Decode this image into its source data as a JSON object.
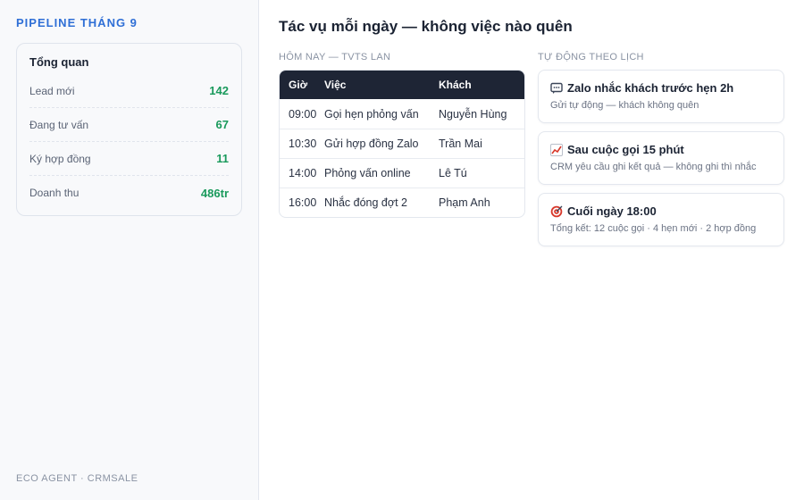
{
  "sidebar": {
    "brand": "PIPELINE THÁNG 9",
    "overview_title": "Tổng quan",
    "stats": [
      {
        "label": "Lead mới",
        "value": "142"
      },
      {
        "label": "Đang tư vấn",
        "value": "67"
      },
      {
        "label": "Ký hợp đồng",
        "value": "11"
      },
      {
        "label": "Doanh thu",
        "value": "486tr"
      }
    ],
    "footer": "ECO AGENT · CRMSALE"
  },
  "main": {
    "title": "Tác vụ mỗi ngày — không việc nào quên",
    "today_label": "Hôm nay — TVTS Lan",
    "schedule_label": "Tự động theo lịch",
    "table": {
      "headers": [
        "Giờ",
        "Việc",
        "Khách"
      ],
      "rows": [
        [
          "09:00",
          "Gọi hẹn phỏng vấn",
          "Nguyễn Hùng"
        ],
        [
          "10:30",
          "Gửi hợp đồng Zalo",
          "Trần Mai"
        ],
        [
          "14:00",
          "Phỏng vấn online",
          "Lê Tú"
        ],
        [
          "16:00",
          "Nhắc đóng đợt 2",
          "Phạm Anh"
        ]
      ]
    },
    "tasks": [
      {
        "icon": "chat-bubble-icon",
        "title": "Zalo nhắc khách trước hẹn 2h",
        "sub": "Gửi tự động — khách không quên"
      },
      {
        "icon": "chart-icon",
        "title": "Sau cuộc gọi 15 phút",
        "sub": "CRM yêu cầu ghi kết quả — không ghi thì nhắc"
      },
      {
        "icon": "target-icon",
        "title": "Cuối ngày 18:00",
        "sub": "Tổng kết: 12 cuộc gọi · 4 hẹn mới · 2 hợp đồng"
      }
    ]
  },
  "colors": {
    "accent": "#2f6fd6",
    "positive": "#1a9a5c",
    "table_header": "#1e2535"
  }
}
